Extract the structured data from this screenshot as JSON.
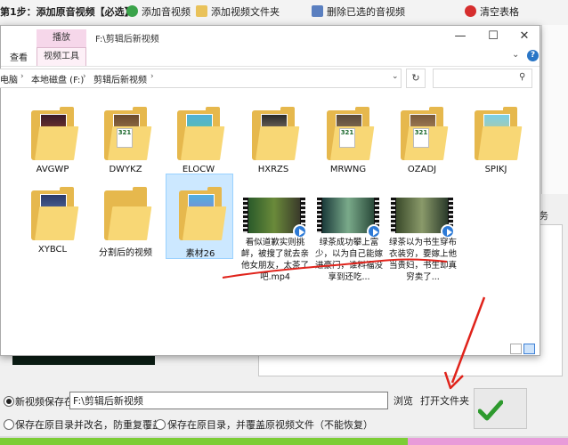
{
  "app_toolbar": {
    "step_label": "第1步：添加原音视频【必选】",
    "add_audio": "添加音视频",
    "add_folder": "添加视频文件夹",
    "delete_checked": "删除已选的音视频",
    "clear_table": "清空表格"
  },
  "explorer": {
    "ribbon_context_tab": "播放",
    "title": "F:\\剪辑后新视频",
    "tab_view": "查看",
    "tab_video_tools": "视频工具",
    "min_symbol": "—",
    "max_symbol": "☐",
    "close_symbol": "✕",
    "breadcrumbs": [
      "电脑",
      "本地磁盘 (F:)",
      "剪辑后新视频"
    ],
    "folders": [
      {
        "name": "AVGWP",
        "badge": ""
      },
      {
        "name": "DWYKZ",
        "badge": "321"
      },
      {
        "name": "ELOCW",
        "badge": ""
      },
      {
        "name": "HXRZS",
        "badge": ""
      },
      {
        "name": "MRWNG",
        "badge": "321"
      },
      {
        "name": "OZADJ",
        "badge": "321"
      },
      {
        "name": "SPIKJ",
        "badge": ""
      },
      {
        "name": "XYBCL",
        "badge": ""
      },
      {
        "name": "分割后的视频",
        "badge": ""
      },
      {
        "name": "素材26",
        "badge": ""
      }
    ],
    "videos": [
      {
        "name": "看似道歉实则挑衅，被搜了就去亲他女朋友，太茶了吧.mp4"
      },
      {
        "name": "绿茶成功攀上富少，以为自己能嫁进豪门，谁料福没享到还吃..."
      },
      {
        "name": "绿茶以为书生穿布衣装穷，要嫁上他当贵妇，书生却真穷卖了..."
      }
    ]
  },
  "bottom_panel": {
    "side_text": "务",
    "save_to_label": "新视频保存在:",
    "save_path": "F:\\剪辑后新视频",
    "browse": "浏览",
    "open_folder": "打开文件夹",
    "option_rename": "保存在原目录并改名，防重复覆盖",
    "option_overwrite": "保存在原目录，并覆盖原视频文件（不能恢复）"
  },
  "colors": {
    "accent_green": "#7ccd35",
    "accent_pink": "#e89bd9",
    "annotation_red": "#e0231b",
    "folder_yellow": "#f8d775"
  },
  "progress": 0.72
}
